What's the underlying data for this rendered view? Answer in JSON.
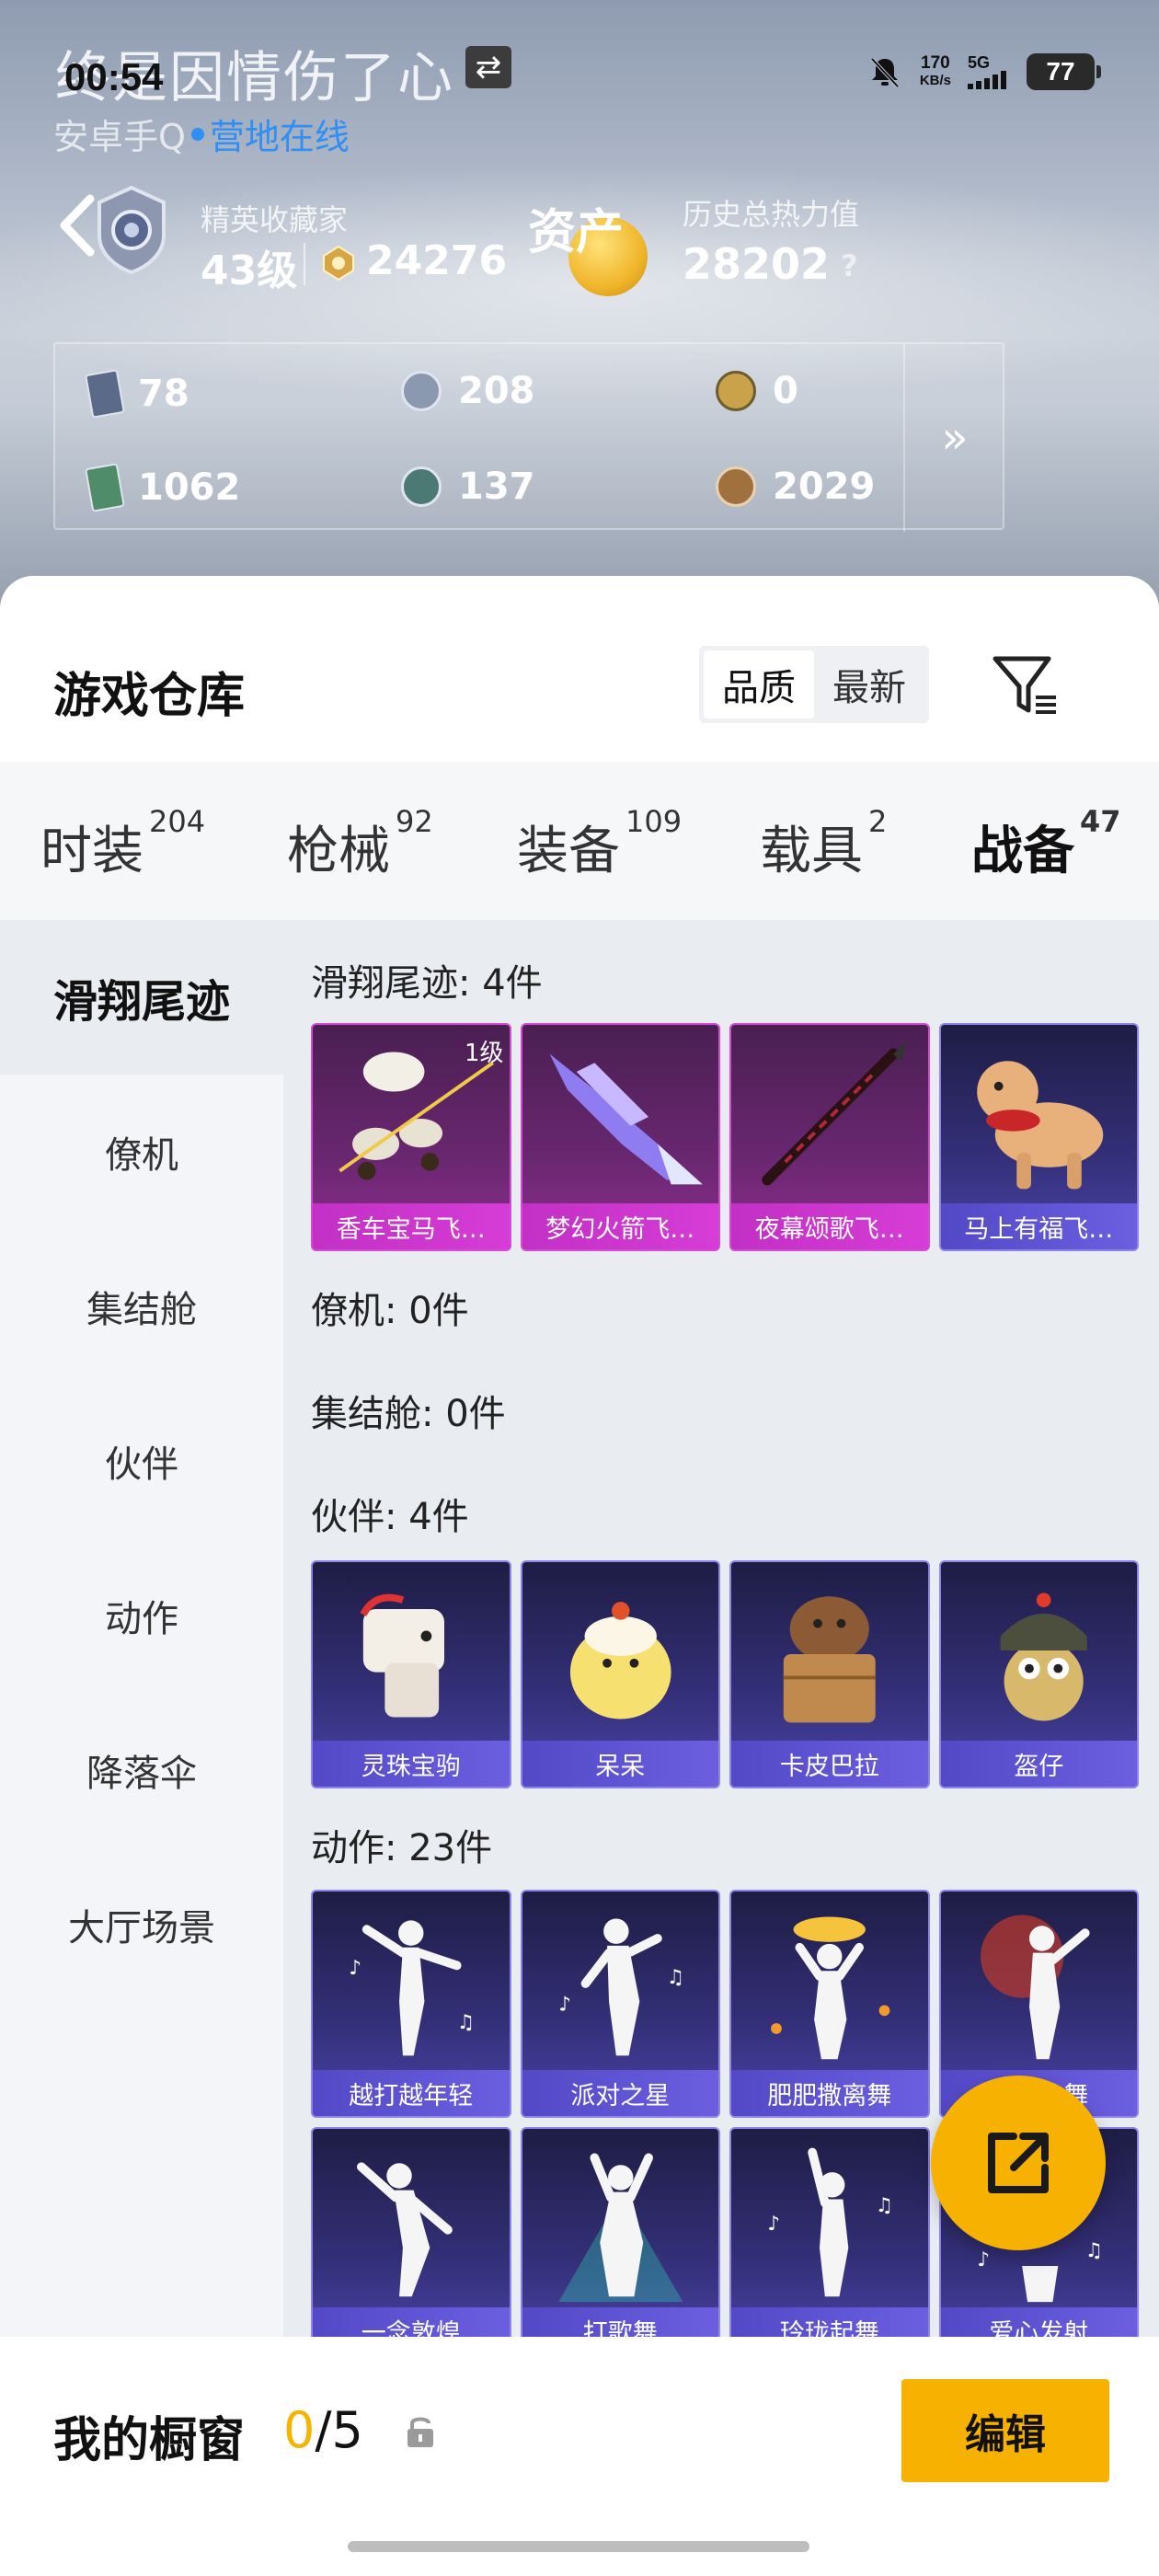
{
  "status_bar": {
    "time": "00:54",
    "speed_value": "170",
    "speed_unit": "KB/s",
    "network": "5G",
    "battery": "77"
  },
  "profile": {
    "name": "终是因情伤了心",
    "platform": "安卓手Q",
    "online_status": "营地在线",
    "rank_title": "精英收藏家",
    "level": "43级",
    "points": "24276",
    "asset_label": "资产",
    "heat_label": "历史总热力值",
    "heat_value": "28202",
    "help": "?"
  },
  "stats": [
    {
      "icon": "card-icon",
      "value": "78",
      "color": "#5b6a88"
    },
    {
      "icon": "silver-coin-icon",
      "value": "208",
      "color": "#8a98b0"
    },
    {
      "icon": "gold-coin-icon",
      "value": "0",
      "color": "#c9a24a"
    },
    {
      "icon": "green-card-icon",
      "value": "1062",
      "color": "#4f8c6a"
    },
    {
      "icon": "token-icon",
      "value": "137",
      "color": "#4b7a74"
    },
    {
      "icon": "bronze-coin-icon",
      "value": "2029",
      "color": "#a0703f"
    }
  ],
  "warehouse": {
    "title": "游戏仓库",
    "sort_options": [
      "品质",
      "最新"
    ],
    "active_sort": "品质"
  },
  "tabs": [
    {
      "label": "时装",
      "count": "204"
    },
    {
      "label": "枪械",
      "count": "92"
    },
    {
      "label": "装备",
      "count": "109"
    },
    {
      "label": "载具",
      "count": "2"
    },
    {
      "label": "战备",
      "count": "47"
    }
  ],
  "sidebar": [
    "滑翔尾迹",
    "僚机",
    "集结舱",
    "伙伴",
    "动作",
    "降落伞",
    "大厅场景"
  ],
  "sections": {
    "glide": {
      "title": "滑翔尾迹: 4件",
      "items": [
        {
          "label": "香车宝马飞…",
          "badge": "1级"
        },
        {
          "label": "梦幻火箭飞…"
        },
        {
          "label": "夜幕颂歌飞…"
        },
        {
          "label": "马上有福飞…"
        }
      ]
    },
    "wingman_title": "僚机: 0件",
    "pod_title": "集结舱: 0件",
    "partner": {
      "title": "伙伴: 4件",
      "items": [
        {
          "label": "灵珠宝驹"
        },
        {
          "label": "呆呆"
        },
        {
          "label": "卡皮巴拉"
        },
        {
          "label": "盔仔"
        }
      ]
    },
    "emote": {
      "title": "动作: 23件",
      "items": [
        {
          "label": "越打越年轻"
        },
        {
          "label": "派对之星"
        },
        {
          "label": "肥肥撒离舞"
        },
        {
          "label": "浪…龙舞"
        },
        {
          "label": "一念敦煌"
        },
        {
          "label": "打歌舞"
        },
        {
          "label": "玲珑起舞"
        },
        {
          "label": "爱心发射"
        }
      ]
    }
  },
  "showcase": {
    "label": "我的橱窗",
    "current": "0",
    "total": "/5",
    "edit_label": "编辑"
  },
  "colors": {
    "accent": "#f7b100",
    "online": "#2f8ff5",
    "card_pink": "#d54ad6",
    "card_blue": "#6b5fe0"
  }
}
